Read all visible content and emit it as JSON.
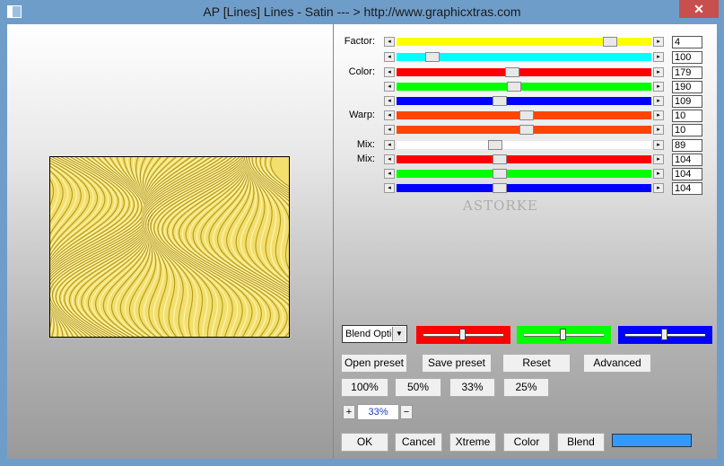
{
  "window": {
    "title": "AP [Lines]  Lines - Satin    --- > http://www.graphicxtras.com",
    "close_glyph": "✕"
  },
  "colors": {
    "yellow": "#ffff00",
    "cyan": "#00ffff",
    "red": "#ff0000",
    "green": "#00ff00",
    "blue": "#0000ff",
    "orange": "#ff4500",
    "white": "#ffffff",
    "swatch": "#3399ff"
  },
  "sliders": [
    {
      "label": "Factor:",
      "color": "#ffff00",
      "value": "4",
      "position": 0.86
    },
    {
      "label": "",
      "color": "#00ffff",
      "value": "100",
      "position": 0.12
    },
    {
      "label": "Color:",
      "color": "#ff0000",
      "value": "179",
      "position": 0.45
    },
    {
      "label": "",
      "color": "#00ff00",
      "value": "190",
      "position": 0.46
    },
    {
      "label": "",
      "color": "#0000ff",
      "value": "109",
      "position": 0.4
    },
    {
      "label": "Warp:",
      "color": "#ff4500",
      "value": "10",
      "position": 0.51
    },
    {
      "label": "",
      "color": "#ff4500",
      "value": "10",
      "position": 0.51
    },
    {
      "label": "Mix:",
      "color": "#ffffff",
      "value": "89",
      "position": 0.38
    },
    {
      "label": "Mix:",
      "color": "#ff0000",
      "value": "104",
      "position": 0.4
    },
    {
      "label": "",
      "color": "#00ff00",
      "value": "104",
      "position": 0.4
    },
    {
      "label": "",
      "color": "#0000ff",
      "value": "104",
      "position": 0.4
    }
  ],
  "watermark": "ASTORKE",
  "blend": {
    "select_value": "Blend Optio",
    "dropdown_glyph": "▼",
    "sliders": [
      {
        "color": "#ff0000",
        "position": 0.49
      },
      {
        "color": "#00ff00",
        "position": 0.49
      },
      {
        "color": "#0000ff",
        "position": 0.49
      }
    ]
  },
  "buttons": {
    "open_preset": "Open preset",
    "save_preset": "Save preset",
    "reset": "Reset",
    "advanced": "Advanced",
    "zoom_100": "100%",
    "zoom_50": "50%",
    "zoom_33": "33%",
    "zoom_25": "25%",
    "ok": "OK",
    "cancel": "Cancel",
    "xtreme": "Xtreme",
    "color": "Color",
    "blend": "Blend"
  },
  "zoom": {
    "plus": "+",
    "value": "33%",
    "minus": "−"
  }
}
